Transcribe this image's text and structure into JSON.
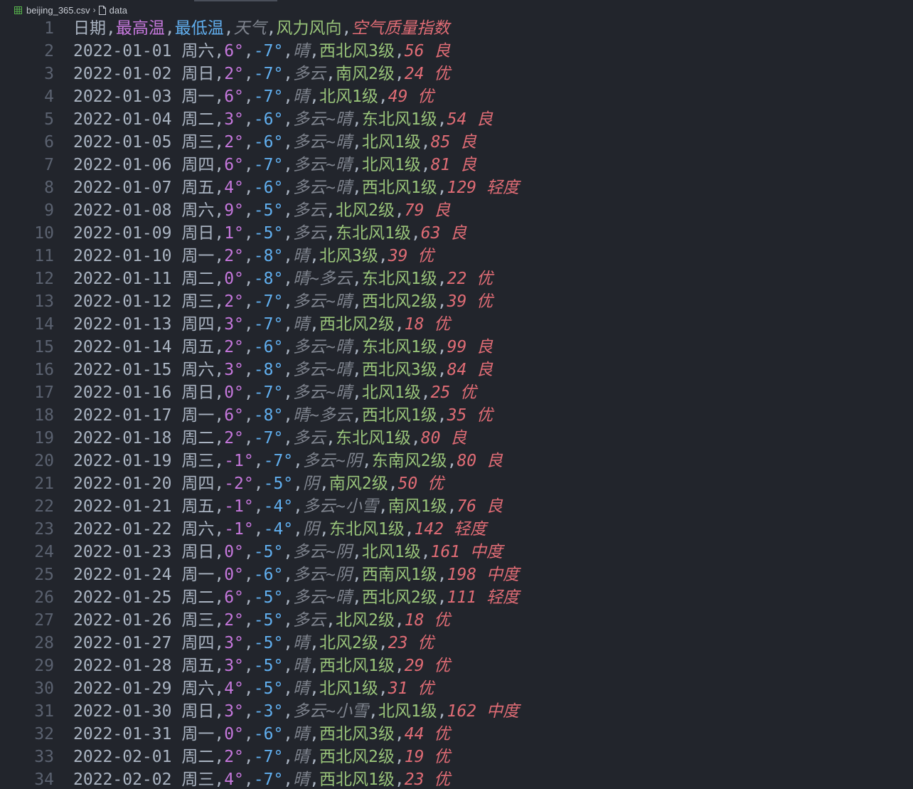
{
  "breadcrumb": {
    "file": "beijing_365.csv",
    "symbol": "data"
  },
  "colors": {
    "background": "#22252c",
    "line_number": "#5b6270",
    "column_0": "#aab4c2",
    "column_1": "#c678dd",
    "column_2": "#61afef",
    "column_3": "#7f848e",
    "column_4": "#98c379",
    "column_5": "#e06c75",
    "csv_icon": "#56b04c"
  },
  "icons": {
    "file": "csv-file-icon",
    "separator": "chevron-right-icon",
    "symbol": "document-icon"
  },
  "lines": [
    {
      "n": "1",
      "cells": [
        "日期",
        "最高温",
        "最低温",
        "天气",
        "风力风向",
        "空气质量指数"
      ]
    },
    {
      "n": "2",
      "cells": [
        "2022-01-01 周六",
        "6°",
        "-7°",
        "晴",
        "西北风3级",
        "56 良"
      ]
    },
    {
      "n": "3",
      "cells": [
        "2022-01-02 周日",
        "2°",
        "-7°",
        "多云",
        "南风2级",
        "24 优"
      ]
    },
    {
      "n": "4",
      "cells": [
        "2022-01-03 周一",
        "6°",
        "-7°",
        "晴",
        "北风1级",
        "49 优"
      ]
    },
    {
      "n": "5",
      "cells": [
        "2022-01-04 周二",
        "3°",
        "-6°",
        "多云~晴",
        "东北风1级",
        "54 良"
      ]
    },
    {
      "n": "6",
      "cells": [
        "2022-01-05 周三",
        "2°",
        "-6°",
        "多云~晴",
        "北风1级",
        "85 良"
      ]
    },
    {
      "n": "7",
      "cells": [
        "2022-01-06 周四",
        "6°",
        "-7°",
        "多云~晴",
        "北风1级",
        "81 良"
      ]
    },
    {
      "n": "8",
      "cells": [
        "2022-01-07 周五",
        "4°",
        "-6°",
        "多云~晴",
        "西北风1级",
        "129 轻度"
      ]
    },
    {
      "n": "9",
      "cells": [
        "2022-01-08 周六",
        "9°",
        "-5°",
        "多云",
        "北风2级",
        "79 良"
      ]
    },
    {
      "n": "10",
      "cells": [
        "2022-01-09 周日",
        "1°",
        "-5°",
        "多云",
        "东北风1级",
        "63 良"
      ]
    },
    {
      "n": "11",
      "cells": [
        "2022-01-10 周一",
        "2°",
        "-8°",
        "晴",
        "北风3级",
        "39 优"
      ]
    },
    {
      "n": "12",
      "cells": [
        "2022-01-11 周二",
        "0°",
        "-8°",
        "晴~多云",
        "东北风1级",
        "22 优"
      ]
    },
    {
      "n": "13",
      "cells": [
        "2022-01-12 周三",
        "2°",
        "-7°",
        "多云~晴",
        "西北风2级",
        "39 优"
      ]
    },
    {
      "n": "14",
      "cells": [
        "2022-01-13 周四",
        "3°",
        "-7°",
        "晴",
        "西北风2级",
        "18 优"
      ]
    },
    {
      "n": "15",
      "cells": [
        "2022-01-14 周五",
        "2°",
        "-6°",
        "多云~晴",
        "东北风1级",
        "99 良"
      ]
    },
    {
      "n": "16",
      "cells": [
        "2022-01-15 周六",
        "3°",
        "-8°",
        "多云~晴",
        "西北风3级",
        "84 良"
      ]
    },
    {
      "n": "17",
      "cells": [
        "2022-01-16 周日",
        "0°",
        "-7°",
        "多云~晴",
        "北风1级",
        "25 优"
      ]
    },
    {
      "n": "18",
      "cells": [
        "2022-01-17 周一",
        "6°",
        "-8°",
        "晴~多云",
        "西北风1级",
        "35 优"
      ]
    },
    {
      "n": "19",
      "cells": [
        "2022-01-18 周二",
        "2°",
        "-7°",
        "多云",
        "东北风1级",
        "80 良"
      ]
    },
    {
      "n": "20",
      "cells": [
        "2022-01-19 周三",
        "-1°",
        "-7°",
        "多云~阴",
        "东南风2级",
        "80 良"
      ]
    },
    {
      "n": "21",
      "cells": [
        "2022-01-20 周四",
        "-2°",
        "-5°",
        "阴",
        "南风2级",
        "50 优"
      ]
    },
    {
      "n": "22",
      "cells": [
        "2022-01-21 周五",
        "-1°",
        "-4°",
        "多云~小雪",
        "南风1级",
        "76 良"
      ]
    },
    {
      "n": "23",
      "cells": [
        "2022-01-22 周六",
        "-1°",
        "-4°",
        "阴",
        "东北风1级",
        "142 轻度"
      ]
    },
    {
      "n": "24",
      "cells": [
        "2022-01-23 周日",
        "0°",
        "-5°",
        "多云~阴",
        "北风1级",
        "161 中度"
      ]
    },
    {
      "n": "25",
      "cells": [
        "2022-01-24 周一",
        "0°",
        "-6°",
        "多云~阴",
        "西南风1级",
        "198 中度"
      ]
    },
    {
      "n": "26",
      "cells": [
        "2022-01-25 周二",
        "6°",
        "-5°",
        "多云~晴",
        "西北风2级",
        "111 轻度"
      ]
    },
    {
      "n": "27",
      "cells": [
        "2022-01-26 周三",
        "2°",
        "-5°",
        "多云",
        "北风2级",
        "18 优"
      ]
    },
    {
      "n": "28",
      "cells": [
        "2022-01-27 周四",
        "3°",
        "-5°",
        "晴",
        "北风2级",
        "23 优"
      ]
    },
    {
      "n": "29",
      "cells": [
        "2022-01-28 周五",
        "3°",
        "-5°",
        "晴",
        "西北风1级",
        "29 优"
      ]
    },
    {
      "n": "30",
      "cells": [
        "2022-01-29 周六",
        "4°",
        "-5°",
        "晴",
        "北风1级",
        "31 优"
      ]
    },
    {
      "n": "31",
      "cells": [
        "2022-01-30 周日",
        "3°",
        "-3°",
        "多云~小雪",
        "北风1级",
        "162 中度"
      ]
    },
    {
      "n": "32",
      "cells": [
        "2022-01-31 周一",
        "0°",
        "-6°",
        "晴",
        "西北风3级",
        "44 优"
      ]
    },
    {
      "n": "33",
      "cells": [
        "2022-02-01 周二",
        "2°",
        "-7°",
        "晴",
        "西北风2级",
        "19 优"
      ]
    },
    {
      "n": "34",
      "cells": [
        "2022-02-02 周三",
        "4°",
        "-7°",
        "晴",
        "西北风1级",
        "23 优"
      ]
    }
  ]
}
